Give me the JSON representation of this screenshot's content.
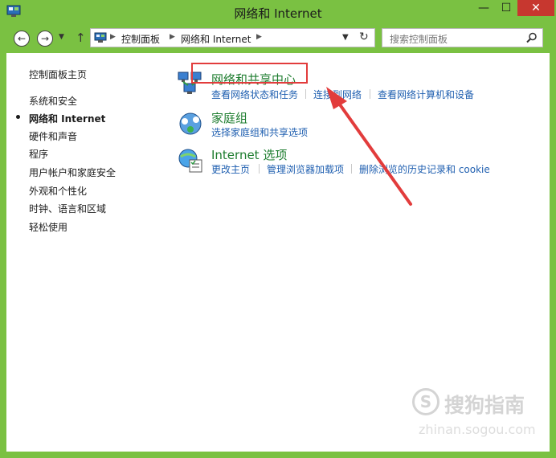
{
  "window": {
    "title": "网络和 Internet",
    "minimize_label": "—",
    "maximize_label": "☐",
    "close_label": "✕"
  },
  "address": {
    "breadcrumbs": [
      "控制面板",
      "网络和 Internet"
    ],
    "search_placeholder": "搜索控制面板"
  },
  "sidebar": {
    "items": [
      {
        "label": "控制面板主页"
      },
      {
        "label": "系统和安全"
      },
      {
        "label": "网络和 Internet",
        "current": true
      },
      {
        "label": "硬件和声音"
      },
      {
        "label": "程序"
      },
      {
        "label": "用户帐户和家庭安全"
      },
      {
        "label": "外观和个性化"
      },
      {
        "label": "时钟、语言和区域"
      },
      {
        "label": "轻松使用"
      }
    ]
  },
  "categories": [
    {
      "title": "网络和共享中心",
      "icon": "network-sharing-icon",
      "links": [
        "查看网络状态和任务",
        "连接到网络",
        "查看网络计算机和设备"
      ]
    },
    {
      "title": "家庭组",
      "icon": "homegroup-icon",
      "links": [
        "选择家庭组和共享选项"
      ]
    },
    {
      "title": "Internet 选项",
      "icon": "internet-options-icon",
      "links": [
        "更改主页",
        "管理浏览器加载项",
        "删除浏览的历史记录和 cookie"
      ]
    }
  ],
  "colors": {
    "window_frame": "#7ac142",
    "category_title": "#1e7d2f",
    "link": "#1f5fb0",
    "annotation": "#e23c3c"
  },
  "watermark": {
    "logo_letter": "S",
    "text": "搜狗指南",
    "url": "zhinan.sogou.com"
  }
}
